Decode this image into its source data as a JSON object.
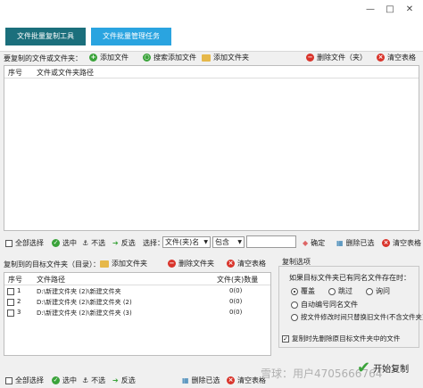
{
  "window": {
    "min": "—",
    "max": "□",
    "close": "✕"
  },
  "tabs": [
    {
      "label": "文件批量复制工具"
    },
    {
      "label": "文件批量管理任务"
    }
  ],
  "source": {
    "label": "要复制的文件或文件夹：",
    "add_file": "添加文件",
    "search_add_file": "搜索添加文件",
    "add_folder": "添加文件夹",
    "delete_file": "删除文件（夹）",
    "clear_table": "清空表格",
    "columns": [
      "序号",
      "文件或文件夹路径"
    ]
  },
  "filter": {
    "select_all": "全部选择",
    "select": "选中",
    "deselect": "不选",
    "invert": "反选",
    "choose_label": "选择：",
    "field_value": "文件(夹)名",
    "mode_value": "包含",
    "confirm": "确定",
    "delete_selected": "删除已选",
    "clear_table": "清空表格"
  },
  "target": {
    "label": "复制到的目标文件夹（目录）：",
    "add_folder": "添加文件夹",
    "delete_folder": "删除文件夹",
    "clear_table": "清空表格",
    "columns": [
      "序号",
      "文件路径",
      "文件(夹)数量"
    ],
    "rows": [
      {
        "index": "1",
        "path": "D:\\新建文件夹 (2)\\新建文件夹",
        "count": "0(0)"
      },
      {
        "index": "2",
        "path": "D:\\新建文件夹 (2)\\新建文件夹 (2)",
        "count": "0(0)"
      },
      {
        "index": "3",
        "path": "D:\\新建文件夹 (2)\\新建文件夹 (3)",
        "count": "0(0)"
      }
    ]
  },
  "copy_options": {
    "title": "复制选项",
    "question": "如果目标文件夹已有同名文件存在时：",
    "overwrite": "覆盖",
    "skip": "跳过",
    "ask": "询问",
    "auto_number": "自动编号同名文件",
    "replace_newer": "按文件修改时间只替换旧文件(不含文件夹)",
    "delete_before": "复制时先删除原目标文件夹中的文件"
  },
  "bottom": {
    "select_all": "全部选择",
    "select": "选中",
    "deselect": "不选",
    "invert": "反选",
    "delete_selected": "删除已选",
    "clear_table": "清空表格",
    "start": "开始复制"
  },
  "watermark": "雪球：用户4705666764",
  "icons": {
    "min": "minimize-icon",
    "max": "maximize-icon",
    "close": "close-icon",
    "add": "plus-circle-icon",
    "search": "search-icon",
    "folder": "folder-icon",
    "delete": "delete-circle-icon",
    "check": "check-circle-icon",
    "arrow": "arrow-icon"
  },
  "colors": {
    "tab_active": "#1b6f7c",
    "tab_inactive": "#2aa4e0",
    "green": "#3aa33a",
    "red": "#d9342b"
  }
}
